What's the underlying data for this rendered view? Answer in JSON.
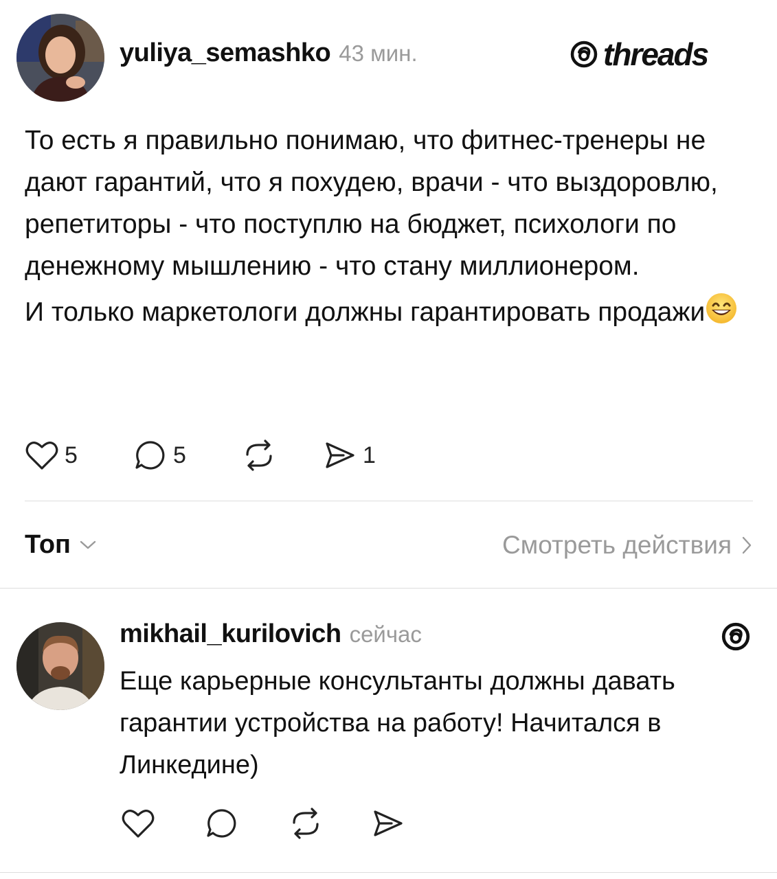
{
  "post": {
    "username": "yuliya_semashko",
    "time": "43 мин.",
    "brand": "threads",
    "paragraphs": [
      "То есть я правильно понимаю, что фитнес-тренеры не дают гарантий, что я похудею, врачи - что выздоровлю, репетиторы - что поступлю на бюджет, психологи по денежному мышлению - что стану миллионером.",
      "И только маркетологи должны гарантировать продажи"
    ],
    "emoji": "grinning-face",
    "likes": "5",
    "replies": "5",
    "shares": "1"
  },
  "controls": {
    "sort_label": "Топ",
    "view_activity": "Смотреть действия"
  },
  "reply": {
    "username": "mikhail_kurilovich",
    "time": "сейчас",
    "text": "Еще карьерные консультанты должны давать гарантии устройства на работу! Начитался в Линкедине)"
  },
  "icons": {
    "like": "heart-icon",
    "comment": "comment-bubble-icon",
    "repost": "repost-icon",
    "share": "send-icon",
    "brand": "threads-logo-icon",
    "sort": "chevron-down-icon",
    "more": "chevron-right-icon"
  }
}
